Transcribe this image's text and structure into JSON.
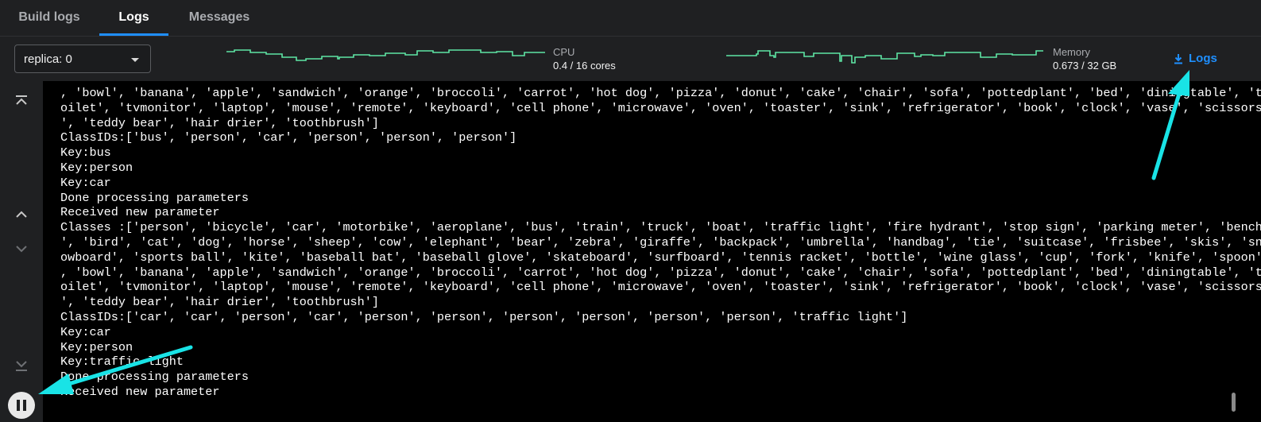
{
  "tabs": [
    {
      "label": "Build logs"
    },
    {
      "label": "Logs",
      "active": true
    },
    {
      "label": "Messages"
    }
  ],
  "toolbar": {
    "replica_select_value": "replica: 0",
    "cpu": {
      "label": "CPU",
      "value": "0.4 / 16 cores"
    },
    "memory": {
      "label": "Memory",
      "value": "0.673 / 32 GB"
    },
    "logs_button_label": "Logs",
    "sparkline_color": "#5ee6a5"
  },
  "log": {
    "lines": [
      ", 'bowl', 'banana', 'apple', 'sandwich', 'orange', 'broccoli', 'carrot', 'hot dog', 'pizza', 'donut', 'cake', 'chair', 'sofa', 'pottedplant', 'bed', 'diningtable', 't",
      "oilet', 'tvmonitor', 'laptop', 'mouse', 'remote', 'keyboard', 'cell phone', 'microwave', 'oven', 'toaster', 'sink', 'refrigerator', 'book', 'clock', 'vase', 'scissors",
      "', 'teddy bear', 'hair drier', 'toothbrush']",
      "ClassIDs:['bus', 'person', 'car', 'person', 'person', 'person']",
      "Key:bus",
      "Key:person",
      "Key:car",
      "Done processing parameters",
      "Received new parameter",
      "Classes :['person', 'bicycle', 'car', 'motorbike', 'aeroplane', 'bus', 'train', 'truck', 'boat', 'traffic light', 'fire hydrant', 'stop sign', 'parking meter', 'bench",
      "', 'bird', 'cat', 'dog', 'horse', 'sheep', 'cow', 'elephant', 'bear', 'zebra', 'giraffe', 'backpack', 'umbrella', 'handbag', 'tie', 'suitcase', 'frisbee', 'skis', 'sn",
      "owboard', 'sports ball', 'kite', 'baseball bat', 'baseball glove', 'skateboard', 'surfboard', 'tennis racket', 'bottle', 'wine glass', 'cup', 'fork', 'knife', 'spoon'",
      ", 'bowl', 'banana', 'apple', 'sandwich', 'orange', 'broccoli', 'carrot', 'hot dog', 'pizza', 'donut', 'cake', 'chair', 'sofa', 'pottedplant', 'bed', 'diningtable', 't",
      "oilet', 'tvmonitor', 'laptop', 'mouse', 'remote', 'keyboard', 'cell phone', 'microwave', 'oven', 'toaster', 'sink', 'refrigerator', 'book', 'clock', 'vase', 'scissors",
      "', 'teddy bear', 'hair drier', 'toothbrush']",
      "ClassIDs:['car', 'car', 'person', 'car', 'person', 'person', 'person', 'person', 'person', 'person', 'traffic light']",
      "Key:car",
      "Key:person",
      "Key:traffic light",
      "Done processing parameters",
      "Received new parameter"
    ]
  },
  "rail": {
    "icons": [
      "scroll-to-top-icon",
      "previous-match-icon",
      "next-match-icon",
      "scroll-to-bottom-icon",
      "pause-icon"
    ]
  },
  "accent_color": "#1f8fff",
  "annotation_color": "#19e3e6"
}
